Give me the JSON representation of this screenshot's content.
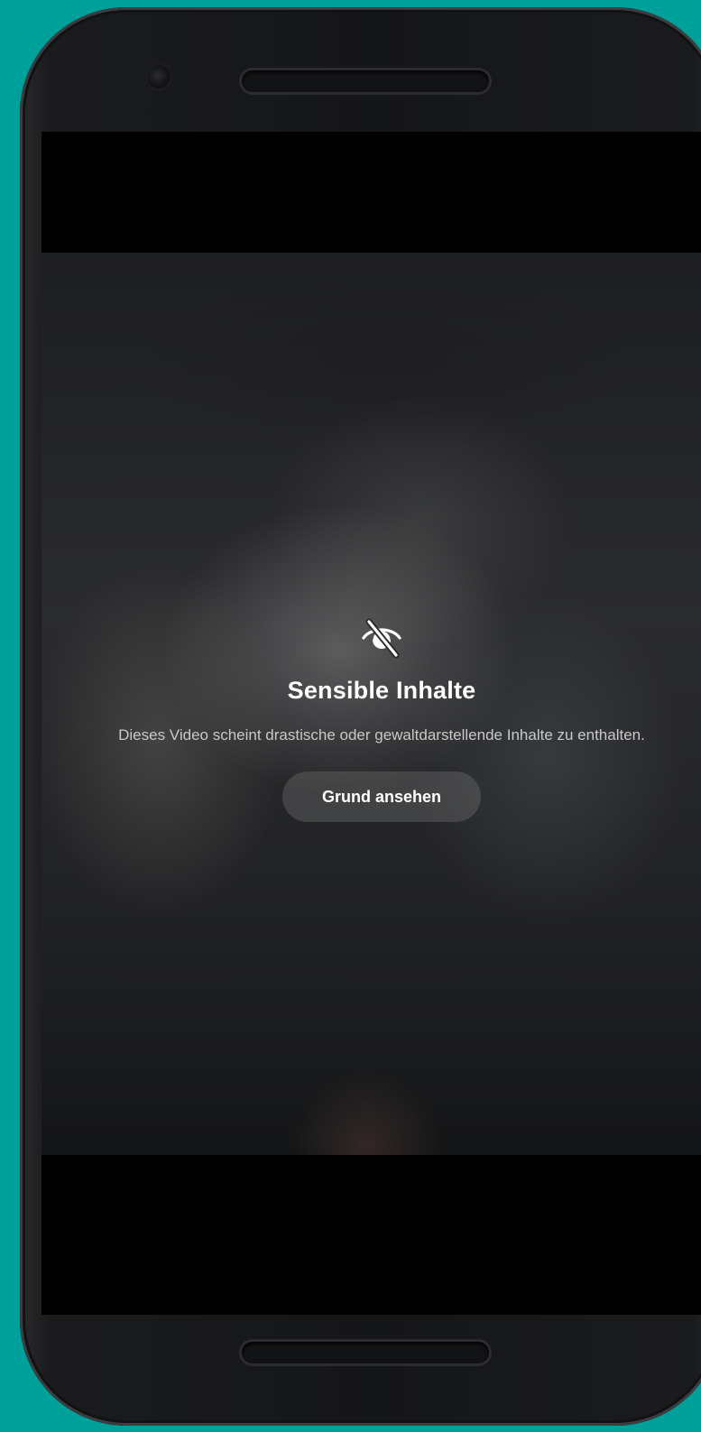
{
  "colors": {
    "background": "#00a09a",
    "phone_body": "#151618",
    "screen_bars": "#000000",
    "title": "#ffffff",
    "description": "#c9c9c9",
    "button_bg": "#5a5a5a"
  },
  "sensitive_overlay": {
    "icon": "eye-slash-icon",
    "title": "Sensible Inhalte",
    "description": "Dieses Video scheint drastische oder gewaltdarstellende Inhalte zu enthalten.",
    "button_label": "Grund ansehen"
  }
}
